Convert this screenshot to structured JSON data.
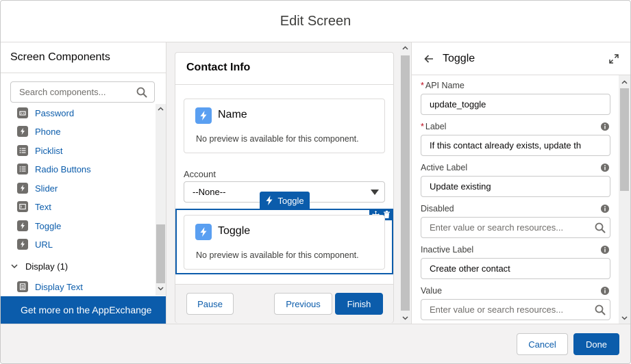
{
  "modal": {
    "title": "Edit Screen"
  },
  "left": {
    "title": "Screen Components",
    "search_placeholder": "Search components...",
    "items": [
      {
        "label": "Password",
        "icon": "password-icon"
      },
      {
        "label": "Phone",
        "icon": "phone-icon"
      },
      {
        "label": "Picklist",
        "icon": "picklist-icon"
      },
      {
        "label": "Radio Buttons",
        "icon": "radio-buttons-icon"
      },
      {
        "label": "Slider",
        "icon": "slider-icon"
      },
      {
        "label": "Text",
        "icon": "text-icon"
      },
      {
        "label": "Toggle",
        "icon": "toggle-icon"
      },
      {
        "label": "URL",
        "icon": "url-icon"
      }
    ],
    "display_section": {
      "label": "Display (1)",
      "items": [
        {
          "label": "Display Text",
          "icon": "display-text-icon"
        }
      ]
    },
    "appexchange": "Get more on the AppExchange"
  },
  "canvas": {
    "title": "Contact Info",
    "name_card": {
      "title": "Name",
      "note": "No preview is available for this component."
    },
    "account": {
      "label": "Account",
      "value": "--None--"
    },
    "selected_tag": "Toggle",
    "toggle_card": {
      "title": "Toggle",
      "note": "No preview is available for this component."
    },
    "buttons": {
      "pause": "Pause",
      "previous": "Previous",
      "finish": "Finish"
    }
  },
  "props": {
    "title": "Toggle",
    "fields": [
      {
        "label": "API Name",
        "required": true,
        "info": false,
        "value": "update_toggle",
        "placeholder": "",
        "search": false
      },
      {
        "label": "Label",
        "required": true,
        "info": true,
        "value": "If this contact already exists, update th",
        "placeholder": "",
        "search": false
      },
      {
        "label": "Active Label",
        "required": false,
        "info": true,
        "value": "Update existing",
        "placeholder": "",
        "search": false
      },
      {
        "label": "Disabled",
        "required": false,
        "info": true,
        "value": "",
        "placeholder": "Enter value or search resources...",
        "search": true
      },
      {
        "label": "Inactive Label",
        "required": false,
        "info": true,
        "value": "Create other contact",
        "placeholder": "",
        "search": false
      },
      {
        "label": "Value",
        "required": false,
        "info": true,
        "value": "",
        "placeholder": "Enter value or search resources...",
        "search": true
      }
    ]
  },
  "footer": {
    "cancel": "Cancel",
    "done": "Done"
  },
  "colors": {
    "brand": "#0b5cab",
    "icon_bolt": "#5a9ff1",
    "required": "#ba0517"
  }
}
